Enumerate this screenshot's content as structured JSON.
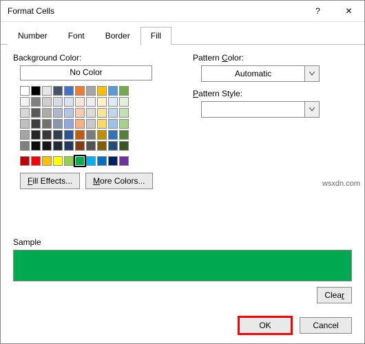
{
  "window": {
    "title": "Format Cells",
    "help": "?",
    "close": "✕"
  },
  "tabs": {
    "items": [
      {
        "label": "Number",
        "active": false
      },
      {
        "label": "Font",
        "active": false
      },
      {
        "label": "Border",
        "active": false
      },
      {
        "label": "Fill",
        "active": true
      }
    ]
  },
  "fill": {
    "bg_label": "Background Color:",
    "no_color_label": "No Color",
    "fill_effects_label": "Fill Effects...",
    "more_colors_label": "More Colors...",
    "theme_rows": [
      [
        "#FFFFFF",
        "#000000",
        "#E7E6E6",
        "#44546A",
        "#4472C4",
        "#ED7D31",
        "#A5A5A5",
        "#FFC000",
        "#5B9BD5",
        "#70AD47"
      ],
      [
        "#F2F2F2",
        "#808080",
        "#D0CECE",
        "#D6DCE4",
        "#D9E2F3",
        "#FBE5D5",
        "#EDEDED",
        "#FFF2CC",
        "#DEEBF6",
        "#E2EFD9"
      ],
      [
        "#D8D8D8",
        "#595959",
        "#AEABAB",
        "#ADB9CA",
        "#B4C6E7",
        "#F7CBAC",
        "#DBDBDB",
        "#FEE599",
        "#BDD7EE",
        "#C5E0B3"
      ],
      [
        "#BFBFBF",
        "#3F3F3F",
        "#757070",
        "#8496B0",
        "#8EAADB",
        "#F4B183",
        "#C9C9C9",
        "#FFD965",
        "#9CC3E5",
        "#A8D08D"
      ],
      [
        "#A5A5A5",
        "#262626",
        "#3A3838",
        "#323F4F",
        "#2F5496",
        "#C55A11",
        "#7B7B7B",
        "#BF9000",
        "#2E75B5",
        "#538135"
      ],
      [
        "#7F7F7F",
        "#0C0C0C",
        "#171616",
        "#222A35",
        "#1F3864",
        "#833C0B",
        "#525252",
        "#7F6000",
        "#1E4E79",
        "#375623"
      ]
    ],
    "standard_row": [
      "#C00000",
      "#FF0000",
      "#FFC000",
      "#FFFF00",
      "#92D050",
      "#00B050",
      "#00B0F0",
      "#0070C0",
      "#002060",
      "#7030A0"
    ],
    "selected_color": "#00B050"
  },
  "pattern": {
    "color_label": "Pattern Color:",
    "color_value": "Automatic",
    "style_label": "Pattern Style:",
    "style_value": ""
  },
  "sample": {
    "label": "Sample",
    "color": "#00A84F"
  },
  "buttons": {
    "clear": "Clear",
    "ok": "OK",
    "cancel": "Cancel"
  },
  "watermark": "wsxdn.com"
}
